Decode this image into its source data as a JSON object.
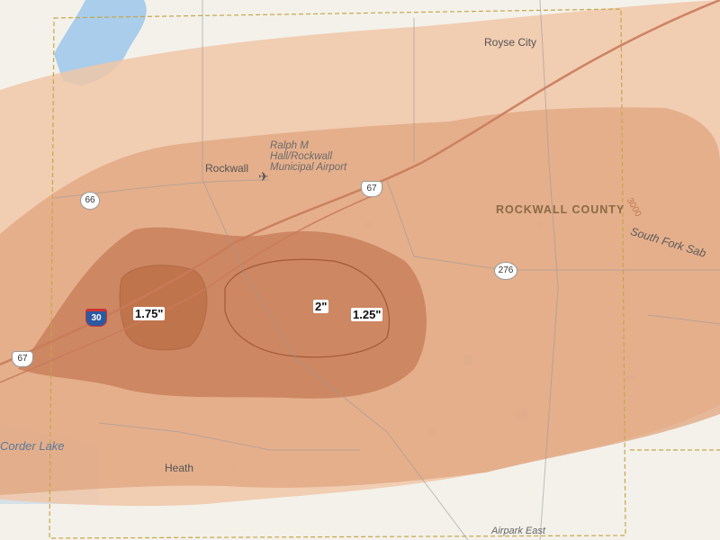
{
  "map": {
    "places": {
      "royse_city": "Royse City",
      "rockwall": "Rockwall",
      "heath": "Heath",
      "airport": [
        "Ralph M",
        "Hall/Rockwall",
        "Municipal Airport"
      ],
      "county": "ROCKWALL COUNTY",
      "lake": "Corder Lake",
      "river": "South Fork Sab",
      "airpark": "Airpark East"
    },
    "highways": {
      "i30": "30",
      "us67_a": "67",
      "us67_b": "67",
      "sh66": "66",
      "sh276": "276",
      "fm3000": "3000"
    },
    "hail_labels": {
      "a": "1.75\"",
      "b": "2\"",
      "c": "1.25\""
    },
    "colors": {
      "swath_light": "#f0c7a8",
      "swath_mid": "#dc9a73",
      "swath_dark": "#b5623d",
      "water": "#a9cdeb",
      "county_border": "#c7a64a",
      "road": "#c97b5a"
    },
    "icons": [
      "airport-icon"
    ]
  }
}
